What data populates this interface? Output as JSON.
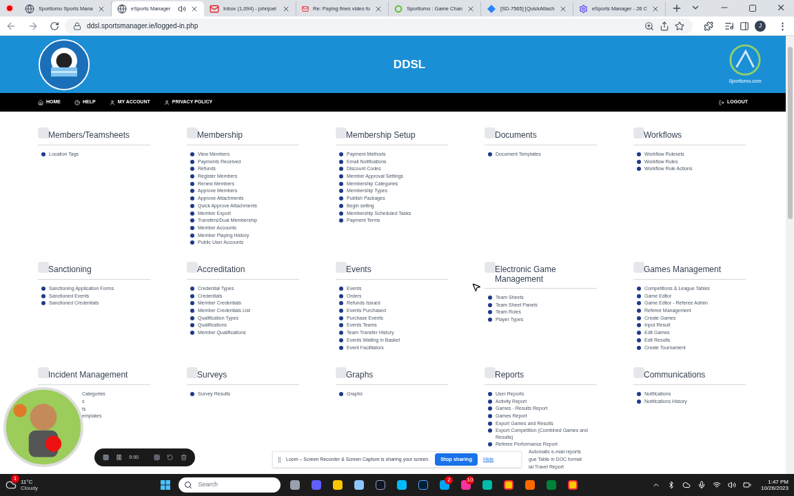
{
  "browser": {
    "tabs": [
      {
        "title": "Sportlomo Sports Mana",
        "selected": false,
        "kind": "globe",
        "audio": false
      },
      {
        "title": "eSports Manager",
        "selected": true,
        "kind": "globe",
        "audio": true
      },
      {
        "title": "Inbox (1,094) - johnjoel",
        "selected": false,
        "kind": "mail",
        "audio": false
      },
      {
        "title": "Re: Paying fines video fo",
        "selected": false,
        "kind": "mail",
        "audio": false
      },
      {
        "title": "Sportlomo : Game Chan",
        "selected": false,
        "kind": "ring",
        "audio": false
      },
      {
        "title": "[SD-7565] [QuickAttach",
        "selected": false,
        "kind": "diamond",
        "audio": false
      },
      {
        "title": "eSports Manager - 26 C",
        "selected": false,
        "kind": "gear",
        "audio": false
      }
    ],
    "url": "ddsl.sportsmanager.ie/logged-in.php",
    "profile": "J",
    "menu": "⋮"
  },
  "header": {
    "title": "DDSL",
    "partner": "Sportlomo.com"
  },
  "nav": {
    "left": [
      {
        "label": "HOME",
        "kind": "home"
      },
      {
        "label": "HELP",
        "kind": "help"
      },
      {
        "label": "MY ACCOUNT",
        "kind": "user"
      },
      {
        "label": "PRIVACY POLICY",
        "kind": "user"
      }
    ],
    "right": [
      {
        "label": "LOGOUT",
        "kind": "logout"
      }
    ]
  },
  "rows": [
    [
      {
        "title": "Members/Teamsheets",
        "items": [
          {
            "text": "Location Tags",
            "kind": "link"
          }
        ]
      },
      {
        "title": "Membership",
        "items": [
          {
            "text": "View Members",
            "kind": "link"
          },
          {
            "text": "Payments Received",
            "kind": "link"
          },
          {
            "text": "Refunds",
            "kind": "link"
          },
          {
            "text": "Register Members",
            "kind": "link"
          },
          {
            "text": "Renew Members",
            "kind": "link"
          },
          {
            "text": "Approve Members",
            "kind": "link"
          },
          {
            "text": "Approve Attachments",
            "kind": "link"
          },
          {
            "text": "Quick Approve Attachments",
            "kind": "link"
          },
          {
            "text": "Member Export",
            "kind": "link"
          },
          {
            "text": "Transfers/Dual Membership",
            "kind": "link"
          },
          {
            "text": "Member Accounts",
            "kind": "link"
          },
          {
            "text": "Member Playing History",
            "kind": "link"
          },
          {
            "text": "Public User Accounts",
            "kind": "link"
          }
        ]
      },
      {
        "title": "Membership Setup",
        "items": [
          {
            "text": "Payment Methods",
            "kind": "link"
          },
          {
            "text": "Email Notifications",
            "kind": "link"
          },
          {
            "text": "Discount Codes",
            "kind": "link"
          },
          {
            "text": "Member Approval Settings",
            "kind": "link"
          },
          {
            "text": "Membership Categories",
            "kind": "link"
          },
          {
            "text": "Membership Types",
            "kind": "link"
          },
          {
            "text": "Publish Packages",
            "kind": "link"
          },
          {
            "text": "Begin selling",
            "kind": "link"
          },
          {
            "text": "Membership Scheduled Tasks",
            "kind": "link"
          },
          {
            "text": "Payment Terms",
            "kind": "link"
          }
        ]
      },
      {
        "title": "Documents",
        "items": [
          {
            "text": "Document Templates",
            "kind": "link"
          }
        ]
      },
      {
        "title": "Workflows",
        "items": [
          {
            "text": "Workflow Rulesets",
            "kind": "link"
          },
          {
            "text": "Workflow Rules",
            "kind": "link"
          },
          {
            "text": "Workflow Rule Actions",
            "kind": "link"
          }
        ]
      }
    ],
    [
      {
        "title": "Sanctioning",
        "items": [
          {
            "text": "Sanctioning Application Forms",
            "kind": "link"
          },
          {
            "text": "Sanctioned Events",
            "kind": "link"
          },
          {
            "text": "Sanctioned Credentials",
            "kind": "link"
          }
        ]
      },
      {
        "title": "Accreditation",
        "items": [
          {
            "text": "Credential Types",
            "kind": "link"
          },
          {
            "text": "Credentials",
            "kind": "link"
          },
          {
            "text": "Member Credentials",
            "kind": "link"
          },
          {
            "text": "Member Credentials List",
            "kind": "link"
          },
          {
            "text": "Qualification Types",
            "kind": "link"
          },
          {
            "text": "Qualifications",
            "kind": "link"
          },
          {
            "text": "Member Qualifications",
            "kind": "link"
          }
        ]
      },
      {
        "title": "Events",
        "items": [
          {
            "text": "Events",
            "kind": "link"
          },
          {
            "text": "Orders",
            "kind": "link"
          },
          {
            "text": "Refunds Issued",
            "kind": "link"
          },
          {
            "text": "Events Purchased",
            "kind": "link"
          },
          {
            "text": "Purchase Events",
            "kind": "link"
          },
          {
            "text": "Events Teams",
            "kind": "link"
          },
          {
            "text": "Team Transfer History",
            "kind": "link"
          },
          {
            "text": "Events Waiting in Basket",
            "kind": "link"
          },
          {
            "text": "Event Facilitators",
            "kind": "link"
          }
        ]
      },
      {
        "title": "Electronic Game Management",
        "items": [
          {
            "text": "Team Sheets",
            "kind": "link"
          },
          {
            "text": "Team Sheet Panels",
            "kind": "link"
          },
          {
            "text": "Team Roles",
            "kind": "link"
          },
          {
            "text": "Player Types",
            "kind": "link"
          }
        ]
      },
      {
        "title": "Games Management",
        "items": [
          {
            "text": "Competitions & League Tables",
            "kind": "link"
          },
          {
            "text": "Game Editor",
            "kind": "link"
          },
          {
            "text": "Game Editor - Referee Admin",
            "kind": "link"
          },
          {
            "text": "Referee Management",
            "kind": "link"
          },
          {
            "text": "Create Games",
            "kind": "link"
          },
          {
            "text": "Input Result",
            "kind": "link"
          },
          {
            "text": "Edit Games",
            "kind": "link"
          },
          {
            "text": "Edit Results",
            "kind": "link"
          },
          {
            "text": "Create Tournament",
            "kind": "link"
          }
        ]
      }
    ],
    [
      {
        "title": "Incident Management",
        "items": [
          {
            "text": "Categories",
            "kind": "partial"
          },
          {
            "text": "s",
            "kind": "partial"
          },
          {
            "text": "ts",
            "kind": "partial"
          },
          {
            "text": "emplates",
            "kind": "partial"
          }
        ]
      },
      {
        "title": "Surveys",
        "items": [
          {
            "text": "Survey Results",
            "kind": "link"
          }
        ]
      },
      {
        "title": "Graphs",
        "items": [
          {
            "text": "Graphs",
            "kind": "link"
          }
        ]
      },
      {
        "title": "Reports",
        "items": [
          {
            "text": "User Reports",
            "kind": "link"
          },
          {
            "text": "Activity Report",
            "kind": "link"
          },
          {
            "text": "Games - Results Report",
            "kind": "link"
          },
          {
            "text": "Games Report",
            "kind": "link"
          },
          {
            "text": "Export Games and Results",
            "kind": "link"
          },
          {
            "text": "Export Competition (Combined Games and Results)",
            "kind": "link"
          },
          {
            "text": "Referee Performance Report",
            "kind": "link"
          },
          {
            "text": "Automatic e-mail reports",
            "kind": "partial"
          },
          {
            "text": "gue Table in DOC format",
            "kind": "partial"
          },
          {
            "text": "ial Travel Report",
            "kind": "partial"
          }
        ]
      },
      {
        "title": "Communications",
        "items": [
          {
            "text": "Notifications",
            "kind": "link"
          },
          {
            "text": "Notifications History",
            "kind": "link"
          }
        ]
      }
    ]
  ],
  "recorder": {
    "time": "0:00"
  },
  "loom": {
    "message": "Loom – Screen Recorder & Screen Capture is sharing your screen.",
    "stop": "Stop sharing",
    "hide": "Hide"
  },
  "taskbar": {
    "temperature": "11°C",
    "weather": "Cloudy",
    "weather_badge": "1",
    "search": "Search",
    "apps": [
      {
        "kind": "files"
      },
      {
        "kind": "chat"
      },
      {
        "kind": "folder"
      },
      {
        "kind": "monitor"
      },
      {
        "kind": "terminal"
      },
      {
        "kind": "photos"
      },
      {
        "kind": "ps"
      },
      {
        "kind": "skype",
        "badge": "2"
      },
      {
        "kind": "slack",
        "badge": "10"
      },
      {
        "kind": "edge"
      },
      {
        "kind": "chrome"
      },
      {
        "kind": "firefox"
      },
      {
        "kind": "excel"
      },
      {
        "kind": "chrome"
      }
    ],
    "time": "1:47 PM",
    "date": "10/26/2023"
  }
}
